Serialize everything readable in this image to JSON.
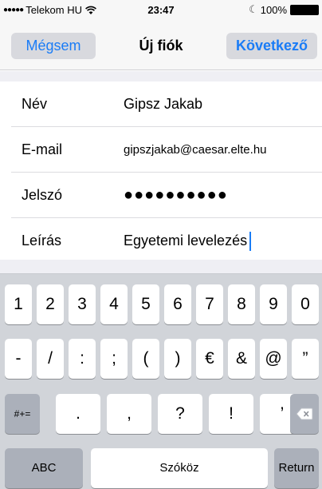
{
  "status_bar": {
    "signal": "●●●●●",
    "carrier": "Telekom HU",
    "time": "23:47",
    "moon_icon": "moon-icon",
    "battery_percent": "100%"
  },
  "nav": {
    "cancel_label": "Mégsem",
    "title": "Új fiók",
    "next_label": "Következő",
    "accent_color": "#1a7cf6"
  },
  "form": {
    "rows": [
      {
        "label": "Név",
        "value": "Gipsz Jakab"
      },
      {
        "label": "E-mail",
        "value": "gipszjakab@caesar.elte.hu"
      },
      {
        "label": "Jelszó",
        "value": "●●●●●●●●●●"
      },
      {
        "label": "Leírás",
        "value": "Egyetemi levelezés"
      }
    ]
  },
  "keyboard": {
    "row1": [
      "1",
      "2",
      "3",
      "4",
      "5",
      "6",
      "7",
      "8",
      "9",
      "0"
    ],
    "row2": [
      "-",
      "/",
      ":",
      ";",
      "(",
      ")",
      "€",
      "&",
      "@",
      "”"
    ],
    "row3_shift": "#+=",
    "row3": [
      ".",
      ",",
      "?",
      "!",
      "’"
    ],
    "backspace_icon": "backspace-icon",
    "abc_label": "ABC",
    "space_label": "Szóköz",
    "return_label": "Return"
  }
}
